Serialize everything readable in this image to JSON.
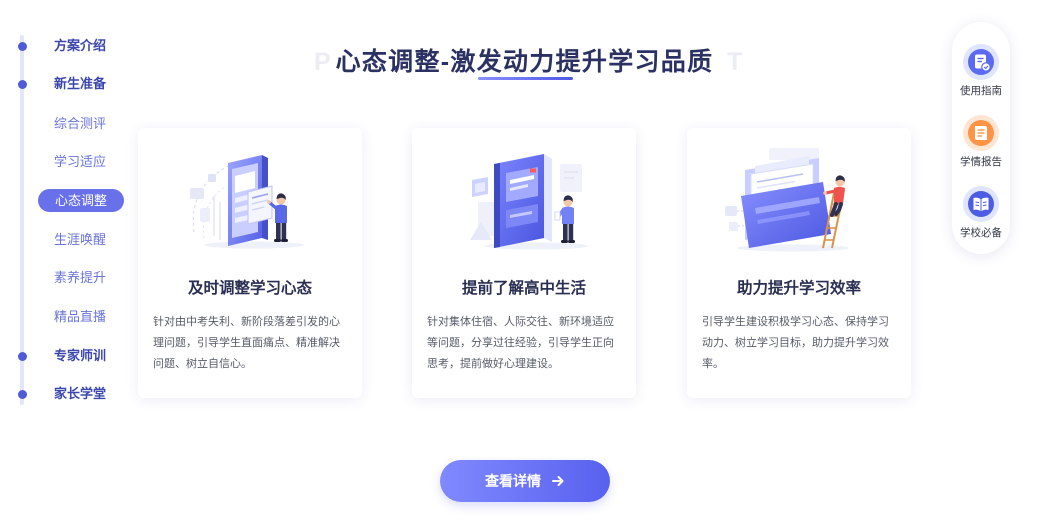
{
  "sidebar": {
    "items": [
      {
        "label": "方案介绍"
      },
      {
        "label": "新生准备"
      },
      {
        "label": "综合测评"
      },
      {
        "label": "学习适应"
      },
      {
        "label": "心态调整"
      },
      {
        "label": "生涯唤醒"
      },
      {
        "label": "素养提升"
      },
      {
        "label": "精品直播"
      },
      {
        "label": "专家师训"
      },
      {
        "label": "家长学堂"
      }
    ]
  },
  "header": {
    "title": "心态调整-激发动力提升学习品质",
    "watermark_letters": [
      "P",
      "T"
    ]
  },
  "cards": [
    {
      "title": "及时调整学习心态",
      "description": "针对由中考失利、新阶段落差引发的心理问题，引导学生直面痛点、精准解决问题、树立自信心。",
      "illustration_icon": "phone-person-illustration"
    },
    {
      "title": "提前了解高中生活",
      "description": "针对集体住宿、人际交往、新环境适应等问题，分享过往经验，引导学生正向思考，提前做好心理建设。",
      "illustration_icon": "book-person-illustration"
    },
    {
      "title": "助力提升学习效率",
      "description": "引导学生建设积极学习心态、保持学习动力、树立学习目标，助力提升学习效率。",
      "illustration_icon": "folder-ladder-illustration"
    }
  ],
  "detail_button": {
    "label": "查看详情",
    "icon": "arrow-right-icon"
  },
  "quick_panel": {
    "items": [
      {
        "label": "使用指南",
        "icon": "guide-document-icon"
      },
      {
        "label": "学情报告",
        "icon": "report-document-icon"
      },
      {
        "label": "学校必备",
        "icon": "school-book-icon"
      }
    ]
  },
  "colors": {
    "accent": "#6870ea",
    "title": "#2c3163",
    "nav_section": "#3b47ad",
    "nav_sub": "#6a74d6",
    "button_start": "#8089ff",
    "button_end": "#5861ee",
    "report_orange": "#ff9346"
  }
}
